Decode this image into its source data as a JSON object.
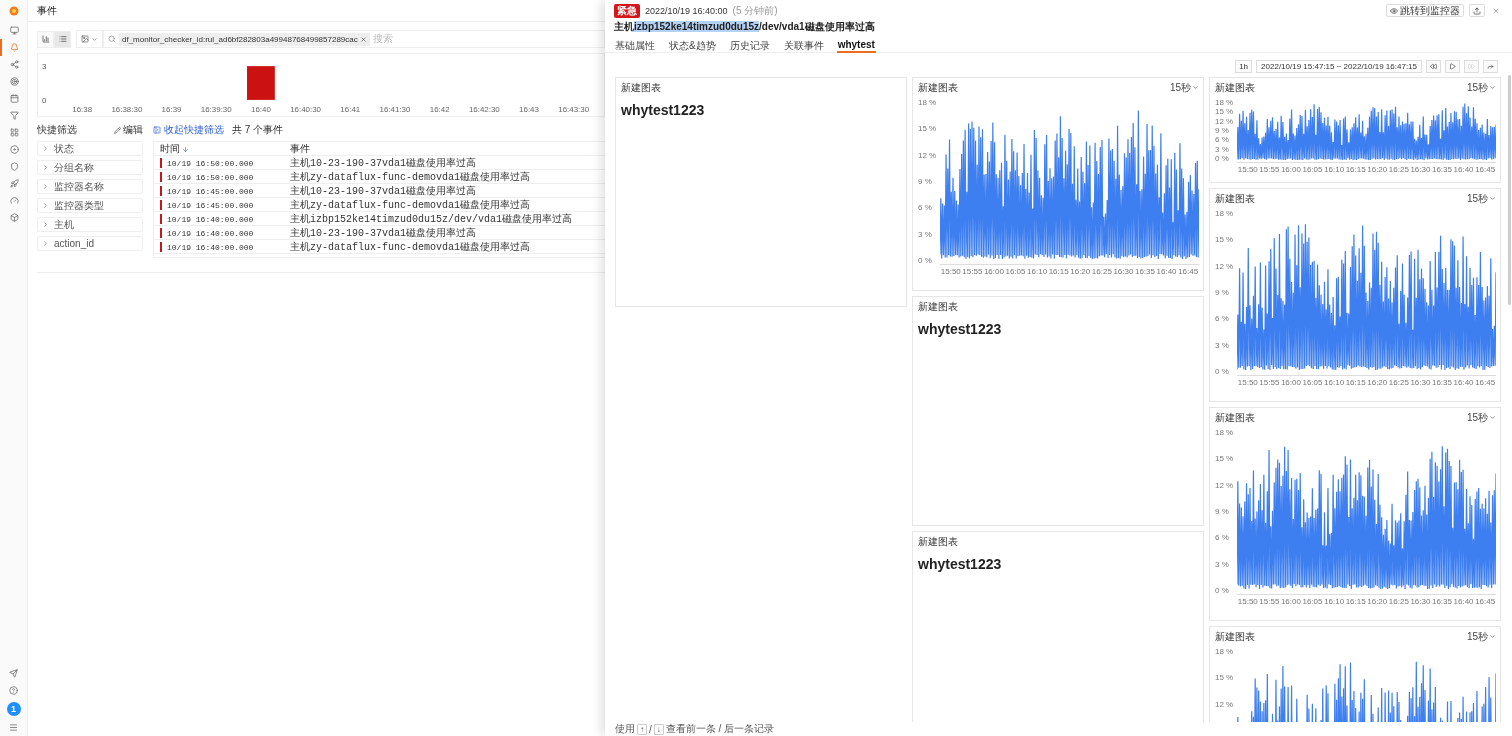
{
  "page_title": "事件",
  "nav": [
    {
      "selected": false
    },
    {
      "selected": true
    },
    {
      "selected": false
    },
    {
      "selected": false
    },
    {
      "selected": false
    },
    {
      "selected": false
    },
    {
      "selected": false
    },
    {
      "selected": false
    },
    {
      "selected": false
    },
    {
      "selected": false
    },
    {
      "selected": false
    },
    {
      "selected": false
    }
  ],
  "notification_count": "1",
  "toolbar": {
    "views": [
      {
        "kind": "chart",
        "selected": false
      },
      {
        "kind": "list",
        "selected": true
      }
    ],
    "filter_tag": "df_monitor_checker_id:rul_ad6bf282803a49948768499857289cac",
    "search_placeholder": "搜索"
  },
  "histogram": {
    "chart_data": {
      "type": "bar",
      "categories": [
        "16:38",
        "16:38:30",
        "16:39",
        "16:39:30",
        "16:40",
        "16:40:30",
        "16:41",
        "16:41:30",
        "16:42",
        "16:42:30",
        "16:43",
        "16:43:30"
      ],
      "values": [
        0,
        0,
        0,
        0,
        3,
        0,
        0,
        0,
        0,
        0,
        0,
        0
      ],
      "ylim": [
        0,
        3
      ],
      "yticks": [
        0,
        3
      ]
    }
  },
  "quick_filter": {
    "title": "快捷筛选",
    "edit": "编辑",
    "collapse": "收起快捷筛选",
    "total": "共 7 个事件",
    "items": [
      {
        "label": "状态",
        "expanded": false
      },
      {
        "label": "分组名称",
        "expanded": false
      },
      {
        "label": "监控器名称",
        "expanded": false
      },
      {
        "label": "监控器类型",
        "expanded": false
      },
      {
        "label": "主机",
        "expanded": false
      },
      {
        "label": "action_id",
        "expanded": false
      }
    ]
  },
  "table": {
    "columns": [
      "时间",
      "事件"
    ],
    "rows": [
      {
        "time": "10/19 16:50:00.000",
        "event": "主机10-23-190-37vda1磁盘使用率过高",
        "color": "#c8161d"
      },
      {
        "time": "10/19 16:50:00.000",
        "event": "主机zy-dataflux-func-demovda1磁盘使用率过高",
        "color": "#c8161d"
      },
      {
        "time": "10/19 16:45:00.000",
        "event": "主机10-23-190-37vda1磁盘使用率过高",
        "color": "#c8161d"
      },
      {
        "time": "10/19 16:45:00.000",
        "event": "主机zy-dataflux-func-demovda1磁盘使用率过高",
        "color": "#c8161d"
      },
      {
        "time": "10/19 16:40:00.000",
        "event": "主机izbp152ke14timzud0du15z/dev/vda1磁盘使用率过高",
        "color": "#c8161d"
      },
      {
        "time": "10/19 16:40:00.000",
        "event": "主机10-23-190-37vda1磁盘使用率过高",
        "color": "#c8161d"
      },
      {
        "time": "10/19 16:40:00.000",
        "event": "主机zy-dataflux-func-demovda1磁盘使用率过高",
        "color": "#c8161d"
      }
    ]
  },
  "drawer": {
    "level": "紧急",
    "time": "2022/10/19 16:40:00",
    "ago": "(5 分钟前)",
    "jump": "跳转到监控器",
    "title_parts": [
      {
        "text": "主机",
        "highlighted": false
      },
      {
        "text": "izbp152ke14timzud0du15z",
        "highlighted": true
      },
      {
        "text": "/dev/vda1磁盘使用率过高",
        "highlighted": false
      }
    ],
    "tabs": [
      {
        "label": "基础属性",
        "selected": false
      },
      {
        "label": "状态&趋势",
        "selected": false
      },
      {
        "label": "历史记录",
        "selected": false
      },
      {
        "label": "关联事件",
        "selected": false
      },
      {
        "label": "whytest",
        "selected": true
      }
    ],
    "range_button": "1h",
    "range": "2022/10/19 15:47:15 ~ 2022/10/19 16:47:15",
    "forward_disabled": true,
    "columns": [
      [
        {
          "kind": "text",
          "title": "新建图表",
          "value": "whytest1223"
        }
      ],
      [
        {
          "kind": "chart",
          "title": "新建图表",
          "interval": "15秒",
          "yticks": [
            "18 %",
            "15 %",
            "12 %",
            "9 %",
            "6 %",
            "3 %",
            "0 %"
          ],
          "xticks": [
            "15:50",
            "15:55",
            "16:00",
            "16:05",
            "16:10",
            "16:15",
            "16:20",
            "16:25",
            "16:30",
            "16:35",
            "16:40",
            "16:45"
          ]
        },
        {
          "kind": "text",
          "title": "新建图表",
          "value": "whytest1223"
        },
        {
          "kind": "text",
          "title": "新建图表",
          "value": "whytest1223"
        }
      ],
      [
        {
          "kind": "mini",
          "title": "新建图表",
          "interval": "15秒",
          "yticks": [
            "18 %",
            "15 %",
            "12 %",
            "9 %",
            "6 %",
            "3 %",
            "0 %"
          ],
          "xticks": [
            "15:50",
            "15:55",
            "16:00",
            "16:05",
            "16:10",
            "16:15",
            "16:20",
            "16:25",
            "16:30",
            "16:35",
            "16:40",
            "16:45"
          ]
        },
        {
          "kind": "chart",
          "title": "新建图表",
          "interval": "15秒",
          "yticks": [
            "18 %",
            "15 %",
            "12 %",
            "9 %",
            "6 %",
            "3 %",
            "0 %"
          ],
          "xticks": [
            "15:50",
            "15:55",
            "16:00",
            "16:05",
            "16:10",
            "16:15",
            "16:20",
            "16:25",
            "16:30",
            "16:35",
            "16:40",
            "16:45"
          ]
        },
        {
          "kind": "chart",
          "title": "新建图表",
          "interval": "15秒",
          "yticks": [
            "18 %",
            "15 %",
            "12 %",
            "9 %",
            "6 %",
            "3 %",
            "0 %"
          ],
          "xticks": [
            "15:50",
            "15:55",
            "16:00",
            "16:05",
            "16:10",
            "16:15",
            "16:20",
            "16:25",
            "16:30",
            "16:35",
            "16:40",
            "16:45"
          ]
        },
        {
          "kind": "chart",
          "title": "新建图表",
          "interval": "15秒",
          "yticks": [
            "18 %",
            "15 %",
            "12 %"
          ]
        }
      ]
    ],
    "footer": {
      "use": "使用",
      "up": "↑",
      "slash": "/",
      "down": "↓",
      "hint": "查看前一条 / 后一条记录"
    }
  }
}
